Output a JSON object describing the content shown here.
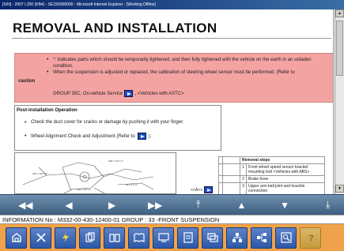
{
  "window": {
    "title": "[S/N] - 2007 L200 (KB4) - SE150000000 - Microsoft Internet Explorer - [Working Offline]"
  },
  "page": {
    "heading": "REMOVAL AND INSTALLATION"
  },
  "caution": {
    "label": "caution",
    "items": [
      "*: Indicates parts which should be temporarily tightened, and then fully tightened with the vehicle on the earth in an unladen condition.",
      "When the suspension is adjusted or replaced, the calibration of steering wheel sensor must be performed. (Refer to"
    ],
    "ref_text": "GROUP 35C, On-vehicle Service",
    "ref_suffix": ", <Vehicles with ASTC>"
  },
  "post_install": {
    "title": "Post-installation Operation",
    "items": [
      "Check the dust cover for cracks or damage by pushing it with your finger.",
      "Wheel Alignment Check and Adjustment (Refer to"
    ],
    "item2_suffix": ")."
  },
  "diagram": {
    "labels": [
      "100 ± 10 N·m*",
      "108 ± 10 N·m*",
      "25 ± 5 N·m",
      "100 ± 10 N·m"
    ]
  },
  "prev_link": {
    "label": "<<A>>"
  },
  "removal_steps": {
    "header": "Removal steps",
    "rows": [
      {
        "num": "1",
        "text": "Front wheel speed sensor bracket mounting bolt <Vehicles with ABS>"
      },
      {
        "num": "2",
        "text": "Brake hose"
      },
      {
        "num": "3",
        "text": "Upper arm ball joint and knuckle connection"
      }
    ]
  },
  "nav": {
    "buttons": [
      "◀◀",
      "◀",
      "▶",
      "▶▶",
      "⤒",
      "▲",
      "▼",
      "⤓"
    ]
  },
  "info": {
    "text": "INFORMATION No : M332-00-430-12400-01 GROUP : 33 -FRONT SUSPENSION"
  },
  "toolbar": {
    "icons": [
      "home-icon",
      "tools-icon",
      "lightning-icon",
      "copy-icon",
      "book-icon",
      "manual-icon",
      "screen-icon",
      "document-icon",
      "window-icon",
      "diagram-icon",
      "diagram2-icon",
      "zoom-icon",
      "help-icon"
    ]
  }
}
